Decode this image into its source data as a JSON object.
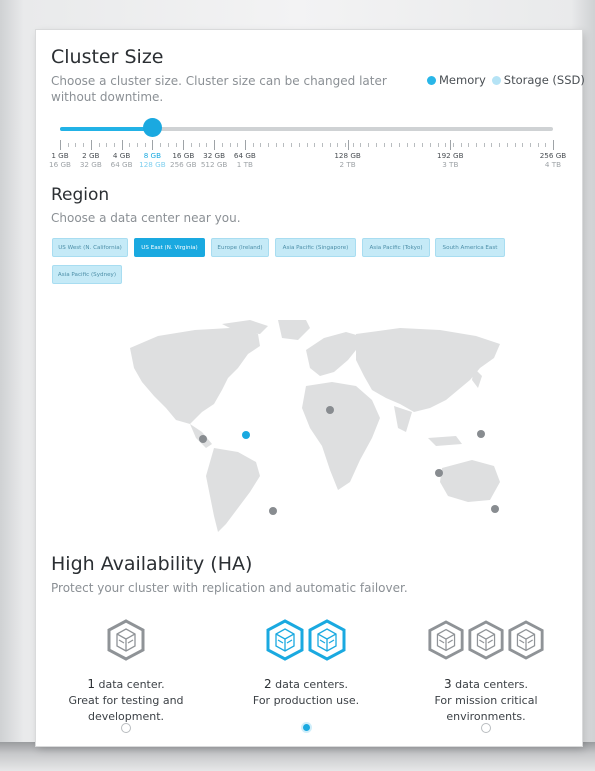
{
  "cluster": {
    "title": "Cluster Size",
    "subtitle": "Choose a cluster size. Cluster size can be changed later without downtime.",
    "legend": {
      "memory": "Memory",
      "storage": "Storage (SSD)",
      "memory_color": "#29b6e8",
      "storage_color": "#b5e3f5"
    },
    "slider": {
      "selected_index": 3,
      "sizes": [
        {
          "memory": "1 GB",
          "storage": "16 GB"
        },
        {
          "memory": "2 GB",
          "storage": "32 GB"
        },
        {
          "memory": "4 GB",
          "storage": "64 GB"
        },
        {
          "memory": "8 GB",
          "storage": "128 GB"
        },
        {
          "memory": "16 GB",
          "storage": "256 GB"
        },
        {
          "memory": "32 GB",
          "storage": "512 GB"
        },
        {
          "memory": "64 GB",
          "storage": "1 TB"
        },
        {
          "memory": "128 GB",
          "storage": "2 TB"
        },
        {
          "memory": "192 GB",
          "storage": "3 TB"
        },
        {
          "memory": "256 GB",
          "storage": "4 TB"
        }
      ]
    }
  },
  "region": {
    "title": "Region",
    "subtitle": "Choose a data center near you.",
    "buttons": [
      {
        "label": "US West (N. California)"
      },
      {
        "label": "US East (N. Virginia)",
        "selected": true
      },
      {
        "label": "Europe (Ireland)"
      },
      {
        "label": "Asia Pacific (Singapore)"
      },
      {
        "label": "Asia Pacific (Tokyo)"
      },
      {
        "label": "South America East"
      },
      {
        "label": "Asia Pacific (Sydney)"
      }
    ]
  },
  "ha": {
    "title": "High Availability (HA)",
    "subtitle": "Protect your cluster with replication and automatic failover.",
    "options": [
      {
        "count": "1",
        "unit": "data center.",
        "line2": "Great for testing and",
        "line3": "development.",
        "selected": false,
        "icon": "datacenter-gray-icon"
      },
      {
        "count": "2",
        "unit": "data centers.",
        "line2": "For production use.",
        "line3": "",
        "selected": true,
        "icon": "datacenter-blue-icon"
      },
      {
        "count": "3",
        "unit": "data centers.",
        "line2": "For mission critical",
        "line3": "environments.",
        "selected": false,
        "icon": "datacenter-gray-icon"
      }
    ]
  },
  "colors": {
    "accent": "#1aa9e0",
    "inactive_icon": "#8f9397"
  }
}
